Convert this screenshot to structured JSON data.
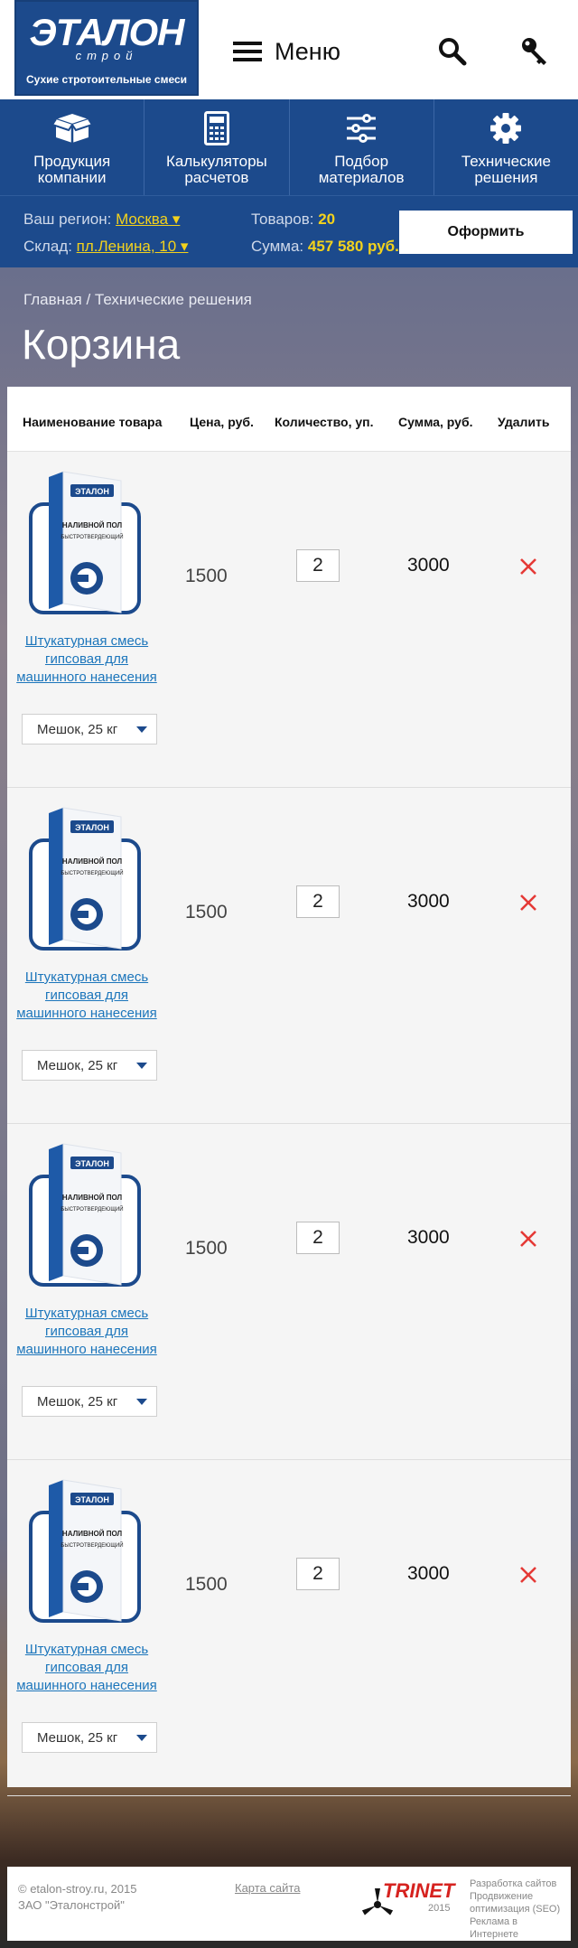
{
  "header": {
    "logo_mark": "ЭТАЛОН",
    "logo_sub": "строй",
    "logo_tag": "Сухие стротоительные смеси",
    "menu_label": "Меню"
  },
  "nav": [
    {
      "label": "Продукция компании",
      "icon": "box-icon"
    },
    {
      "label": "Калькуляторы расчетов",
      "icon": "calculator-icon"
    },
    {
      "label": "Подбор материалов",
      "icon": "sliders-icon"
    },
    {
      "label": "Технические решения",
      "icon": "gear-icon"
    }
  ],
  "info": {
    "region_label": "Ваш регион:",
    "region_value": "Москва ▾",
    "warehouse_label": "Склад:",
    "warehouse_value": "пл.Ленина, 10 ▾",
    "items_label": "Товаров:",
    "items_value": "20",
    "sum_label": "Сумма:",
    "sum_value": "457 580 руб.",
    "order_button": "Оформить"
  },
  "breadcrumb": {
    "home": "Главная",
    "sep": " / ",
    "current": "Технические решения"
  },
  "page_title": "Корзина",
  "cart": {
    "columns": [
      "Наименование товара",
      "Цена, руб.",
      "Количество, уп.",
      "Сумма, руб.",
      "Удалить"
    ],
    "product_box_text": {
      "brand": "ЭТАЛОН",
      "line1": "НАЛИВНОЙ ПОЛ",
      "line2": "БЫСТРОТВЕРДЕЮЩИЙ"
    },
    "items": [
      {
        "name": "Штукатурная смесь гипсовая для машинного нанесения",
        "pack": "Мешок,  25 кг",
        "price": "1500",
        "qty": "2",
        "sum": "3000"
      },
      {
        "name": "Штукатурная смесь гипсовая для машинного нанесения",
        "pack": "Мешок,  25 кг",
        "price": "1500",
        "qty": "2",
        "sum": "3000"
      },
      {
        "name": "Штукатурная смесь гипсовая для машинного нанесения",
        "pack": "Мешок,  25 кг",
        "price": "1500",
        "qty": "2",
        "sum": "3000"
      },
      {
        "name": "Штукатурная смесь гипсовая для машинного нанесения",
        "pack": "Мешок,  25 кг",
        "price": "1500",
        "qty": "2",
        "sum": "3000"
      }
    ]
  },
  "footer": {
    "copyright": "© etalon-stroy.ru, 2015",
    "company": "ЗАО \"Эталонстрой\"",
    "sitemap": "Карта сайта",
    "dev_brand": "TRINET",
    "dev_year": "2015",
    "dev_lines": [
      "Разработка сайтов",
      "Продвижение",
      "оптимизация (SEO)",
      "Реклама в Интернете"
    ]
  },
  "colors": {
    "brand_blue": "#1c4a8c",
    "accent_yellow": "#f3d21c",
    "link_blue": "#1b75bb",
    "delete_red": "#e53935"
  }
}
